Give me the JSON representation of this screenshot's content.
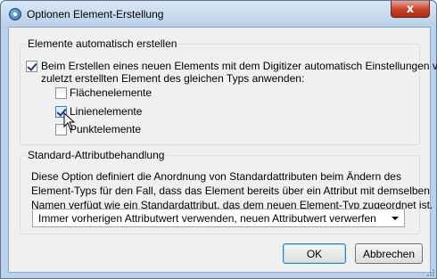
{
  "window": {
    "title": "Optionen Element-Erstellung",
    "close_symbol": "x"
  },
  "auto_create": {
    "legend": "Elemente automatisch erstellen",
    "main_option": {
      "checked": true,
      "label_line1": "Beim Erstellen eines neuen Elements mit dem Digitizer automatisch Einstellungen vom",
      "label_line2": "zuletzt erstellten Element des gleichen Typs anwenden:"
    },
    "sub_options": [
      {
        "label": "Flächenelemente",
        "checked": false
      },
      {
        "label": "Linienelemente",
        "checked": true
      },
      {
        "label": "Punktelemente",
        "checked": false
      }
    ]
  },
  "attribute_handling": {
    "legend": "Standard-Attributbehandlung",
    "description_lines": [
      "Diese Option definiert die Anordnung von Standardattributen beim Ändern des",
      "Element-Typs für den Fall, dass das Element bereits über ein Attribut mit demselben",
      "Namen verfügt wie ein Standardattribut, das dem neuen Element-Typ zugeordnet ist."
    ],
    "dropdown_value": "Immer vorherigen Attributwert verwenden, neuen Attributwert verwerfen"
  },
  "buttons": {
    "ok": "OK",
    "cancel": "Abbrechen"
  },
  "icons": {
    "app": "globe-icon",
    "close": "close-icon",
    "cursor": "mouse-pointer-icon",
    "dropdown": "chevron-down-icon",
    "resize": "resize-grip-icon"
  }
}
